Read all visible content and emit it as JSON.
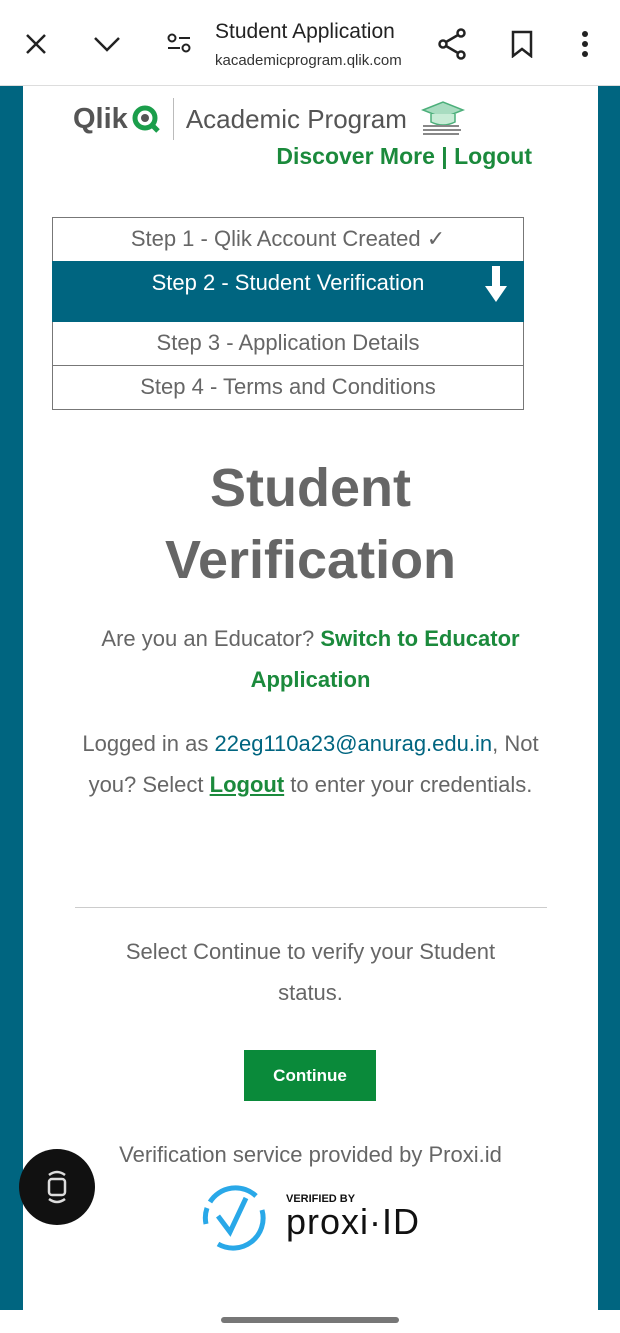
{
  "browser": {
    "title": "Student Application",
    "url": "kacademicprogram.qlik.com",
    "icons": [
      "close-icon",
      "chevron-down-icon",
      "site-settings-icon",
      "share-icon",
      "bookmark-icon",
      "more-icon"
    ]
  },
  "header": {
    "brand": "Qlik",
    "program": "Academic Program",
    "discover": "Discover More",
    "divider": "|",
    "logout": "Logout"
  },
  "steps": [
    {
      "label": "Step 1 - Qlik Account Created ✓",
      "state": "done"
    },
    {
      "label": "Step 2 - Student Verification",
      "state": "active"
    },
    {
      "label": "Step 3 - Application Details",
      "state": "pending"
    },
    {
      "label": "Step 4 - Terms and Conditions",
      "state": "pending"
    }
  ],
  "main": {
    "heading_1": "Student",
    "heading_2": "Verification",
    "educator_q": "Are you an Educator? ",
    "educator_link": "Switch to Educator Application",
    "logged_prefix": "Logged in as ",
    "email": "22eg110a23@anurag.edu.in",
    "logged_mid": ", Not you? Select ",
    "logout_link": "Logout",
    "logged_suffix": " to enter your credentials.",
    "continue_text": "Select Continue to verify your Student status.",
    "continue_button": "Continue",
    "provider": "Verification service provided by Proxi.id",
    "badge_top": "VERIFIED BY",
    "badge_brand": "proxi·ID"
  },
  "colors": {
    "teal": "#006580",
    "green": "#1b8a3c",
    "proxi_blue": "#29a8e8"
  }
}
